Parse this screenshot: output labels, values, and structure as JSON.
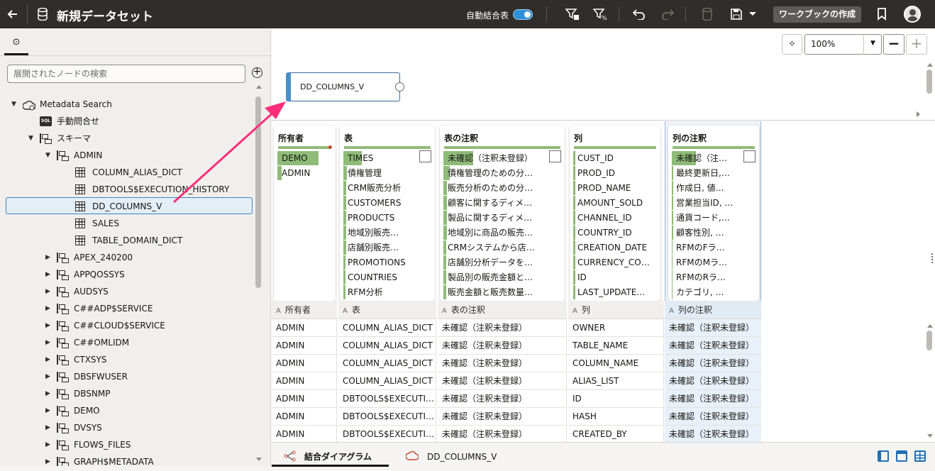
{
  "topbar": {
    "title": "新規データセット",
    "autojoin_label": "自動結合表",
    "autojoin_on": true,
    "create_workbook": "ワークブックの作成"
  },
  "left": {
    "search_placeholder": "展開されたノードの検索",
    "tree": [
      {
        "label": "Metadata Search",
        "expanded": true
      },
      {
        "label": "手動問合せ",
        "icon": "sql-icon",
        "icon_text": "SQL"
      },
      {
        "label": "スキーマ",
        "expanded": true
      },
      {
        "label": "ADMIN",
        "expanded": true
      },
      {
        "label": "COLUMN_ALIAS_DICT"
      },
      {
        "label": "DBTOOLS$EXECUTION_HISTORY"
      },
      {
        "label": "DD_COLUMNS_V",
        "selected": true
      },
      {
        "label": "SALES"
      },
      {
        "label": "TABLE_DOMAIN_DICT"
      },
      {
        "label": "APEX_240200"
      },
      {
        "label": "APPQOSSYS"
      },
      {
        "label": "AUDSYS"
      },
      {
        "label": "C##ADP$SERVICE"
      },
      {
        "label": "C##CLOUD$SERVICE"
      },
      {
        "label": "C##OMLIDM"
      },
      {
        "label": "CTXSYS"
      },
      {
        "label": "DBSFWUSER"
      },
      {
        "label": "DBSNMP"
      },
      {
        "label": "DEMO"
      },
      {
        "label": "DVSYS"
      },
      {
        "label": "FLOWS_FILES"
      },
      {
        "label": "GRAPH$METADATA"
      }
    ]
  },
  "canvas": {
    "node_label": "DD_COLUMNS_V",
    "zoom": "100%"
  },
  "profiles": [
    {
      "title": "所有者",
      "items": [
        {
          "label": "DEMO",
          "fill": 1.0
        },
        {
          "label": "ADMIN",
          "fill": 0.08
        }
      ]
    },
    {
      "title": "表",
      "items": [
        {
          "label": "TIMES",
          "fill": 0.25
        },
        {
          "label": "債権管理",
          "fill": 0.04
        },
        {
          "label": "CRM販売分析",
          "fill": 0.03
        },
        {
          "label": "CUSTOMERS",
          "fill": 0.03
        },
        {
          "label": "PRODUCTS",
          "fill": 0.03
        },
        {
          "label": "地域別販売…",
          "fill": 0.03
        },
        {
          "label": "店舗別販売…",
          "fill": 0.03
        },
        {
          "label": "PROMOTIONS",
          "fill": 0.02
        },
        {
          "label": "COUNTRIES",
          "fill": 0.02
        },
        {
          "label": "RFM分析",
          "fill": 0.02
        }
      ]
    },
    {
      "title": "表の注釈",
      "items": [
        {
          "label": "未確認（注釈未登録）",
          "fill": 0.3
        },
        {
          "label": "債権管理のための分…",
          "fill": 0.06
        },
        {
          "label": "販売分析のための分…",
          "fill": 0.03
        },
        {
          "label": "顧客に関するディメ…",
          "fill": 0.03
        },
        {
          "label": "製品に関するディメ…",
          "fill": 0.03
        },
        {
          "label": "地域別に商品の販売…",
          "fill": 0.03
        },
        {
          "label": "CRMシステムから店…",
          "fill": 0.02
        },
        {
          "label": "店舗別分析データを…",
          "fill": 0.02
        },
        {
          "label": "製品別の販売金額と…",
          "fill": 0.02
        },
        {
          "label": "販売金額と販売数量…",
          "fill": 0.02
        }
      ]
    },
    {
      "title": "列",
      "items": [
        {
          "label": "CUST_ID",
          "fill": 0.02
        },
        {
          "label": "PROD_ID",
          "fill": 0.02
        },
        {
          "label": "PROD_NAME",
          "fill": 0.02
        },
        {
          "label": "AMOUNT_SOLD",
          "fill": 0.02
        },
        {
          "label": "CHANNEL_ID",
          "fill": 0.02
        },
        {
          "label": "COUNTRY_ID",
          "fill": 0.02
        },
        {
          "label": "CREATION_DATE",
          "fill": 0.02
        },
        {
          "label": "CURRENCY_CO…",
          "fill": 0.02
        },
        {
          "label": "ID",
          "fill": 0.02
        },
        {
          "label": "LAST_UPDATE…",
          "fill": 0.02
        }
      ]
    },
    {
      "title": "列の注釈",
      "items": [
        {
          "label": "未確認（注…",
          "fill": 0.35
        },
        {
          "label": "最終更新日,…",
          "fill": 0.01
        },
        {
          "label": "作成日, 値…",
          "fill": 0.01
        },
        {
          "label": "営業担当ID, …",
          "fill": 0.01
        },
        {
          "label": "通貨コード,…",
          "fill": 0.01
        },
        {
          "label": "顧客性別, …",
          "fill": 0.01
        },
        {
          "label": "RFMのFラ…",
          "fill": 0.0
        },
        {
          "label": "RFMのMラ…",
          "fill": 0.0
        },
        {
          "label": "RFMのRラ…",
          "fill": 0.0
        },
        {
          "label": "カテゴリ, …",
          "fill": 0.0
        }
      ]
    }
  ],
  "columns": [
    "所有者",
    "表",
    "表の注釈",
    "列",
    "列の注釈"
  ],
  "rows": [
    [
      "ADMIN",
      "COLUMN_ALIAS_DICT",
      "未確認（注釈未登録）",
      "OWNER",
      "未確認（注釈未登録）"
    ],
    [
      "ADMIN",
      "COLUMN_ALIAS_DICT",
      "未確認（注釈未登録）",
      "TABLE_NAME",
      "未確認（注釈未登録）"
    ],
    [
      "ADMIN",
      "COLUMN_ALIAS_DICT",
      "未確認（注釈未登録）",
      "COLUMN_NAME",
      "未確認（注釈未登録）"
    ],
    [
      "ADMIN",
      "COLUMN_ALIAS_DICT",
      "未確認（注釈未登録）",
      "ALIAS_LIST",
      "未確認（注釈未登録）"
    ],
    [
      "ADMIN",
      "DBTOOLS$EXECUTI…",
      "未確認（注釈未登録）",
      "ID",
      "未確認（注釈未登録）"
    ],
    [
      "ADMIN",
      "DBTOOLS$EXECUTI…",
      "未確認（注釈未登録）",
      "HASH",
      "未確認（注釈未登録）"
    ],
    [
      "ADMIN",
      "DBTOOLS$EXECUTI…",
      "未確認（注釈未登録）",
      "CREATED_BY",
      "未確認（注釈未登録）"
    ]
  ],
  "bottom": {
    "tab1": "結合ダイアグラム",
    "tab2": "DD_COLUMNS_V"
  },
  "colors": {
    "topbar": "#312d2a",
    "accent": "#2f8fd8",
    "bar": "#8fbb78",
    "arrow": "#ff2d78"
  }
}
